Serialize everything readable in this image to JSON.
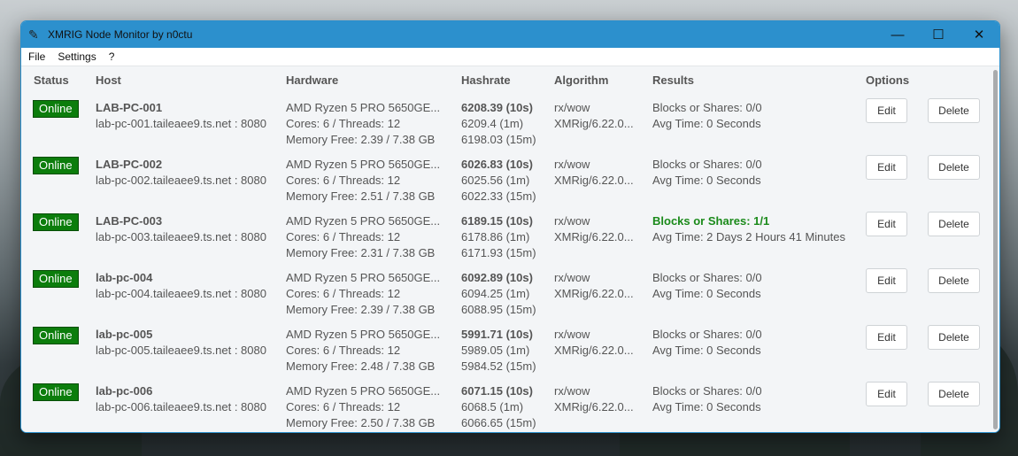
{
  "window": {
    "title": "XMRIG Node Monitor by n0ctu",
    "minimize": "—",
    "maximize": "☐",
    "close": "✕"
  },
  "menu": [
    "File",
    "Settings",
    "?"
  ],
  "headers": [
    "Status",
    "Host",
    "Hardware",
    "Hashrate",
    "Algorithm",
    "Results",
    "Options"
  ],
  "rows": [
    {
      "status": "Online",
      "name": "LAB-PC-001",
      "address": "lab-pc-001.taileaee9.ts.net : 8080",
      "cpu": "AMD Ryzen 5 PRO 5650GE...",
      "cores": "Cores: 6 / Threads: 12",
      "memory": "Memory Free: 2.39 / 7.38 GB",
      "h10s": "6208.39 (10s)",
      "h1m": "6209.4 (1m)",
      "h15m": "6198.03 (15m)",
      "algo": "rx/wow",
      "version": "XMRig/6.22.0...",
      "shares": "Blocks or Shares: 0/0",
      "avg": "Avg Time: 0 Seconds",
      "found": false,
      "edit": "Edit",
      "delete": "Delete"
    },
    {
      "status": "Online",
      "name": "LAB-PC-002",
      "address": "lab-pc-002.taileaee9.ts.net : 8080",
      "cpu": "AMD Ryzen 5 PRO 5650GE...",
      "cores": "Cores: 6 / Threads: 12",
      "memory": "Memory Free: 2.51 / 7.38 GB",
      "h10s": "6026.83 (10s)",
      "h1m": "6025.56 (1m)",
      "h15m": "6022.33 (15m)",
      "algo": "rx/wow",
      "version": "XMRig/6.22.0...",
      "shares": "Blocks or Shares: 0/0",
      "avg": "Avg Time: 0 Seconds",
      "found": false,
      "edit": "Edit",
      "delete": "Delete"
    },
    {
      "status": "Online",
      "name": "LAB-PC-003",
      "address": "lab-pc-003.taileaee9.ts.net : 8080",
      "cpu": "AMD Ryzen 5 PRO 5650GE...",
      "cores": "Cores: 6 / Threads: 12",
      "memory": "Memory Free: 2.31 / 7.38 GB",
      "h10s": "6189.15 (10s)",
      "h1m": "6178.86 (1m)",
      "h15m": "6171.93 (15m)",
      "algo": "rx/wow",
      "version": "XMRig/6.22.0...",
      "shares": "Blocks or Shares: 1/1",
      "avg": "Avg Time: 2 Days 2 Hours 41 Minutes",
      "found": true,
      "edit": "Edit",
      "delete": "Delete"
    },
    {
      "status": "Online",
      "name": "lab-pc-004",
      "address": "lab-pc-004.taileaee9.ts.net : 8080",
      "cpu": "AMD Ryzen 5 PRO 5650GE...",
      "cores": "Cores: 6 / Threads: 12",
      "memory": "Memory Free: 2.39 / 7.38 GB",
      "h10s": "6092.89 (10s)",
      "h1m": "6094.25 (1m)",
      "h15m": "6088.95 (15m)",
      "algo": "rx/wow",
      "version": "XMRig/6.22.0...",
      "shares": "Blocks or Shares: 0/0",
      "avg": "Avg Time: 0 Seconds",
      "found": false,
      "edit": "Edit",
      "delete": "Delete"
    },
    {
      "status": "Online",
      "name": "lab-pc-005",
      "address": "lab-pc-005.taileaee9.ts.net : 8080",
      "cpu": "AMD Ryzen 5 PRO 5650GE...",
      "cores": "Cores: 6 / Threads: 12",
      "memory": "Memory Free: 2.48 / 7.38 GB",
      "h10s": "5991.71 (10s)",
      "h1m": "5989.05 (1m)",
      "h15m": "5984.52 (15m)",
      "algo": "rx/wow",
      "version": "XMRig/6.22.0...",
      "shares": "Blocks or Shares: 0/0",
      "avg": "Avg Time: 0 Seconds",
      "found": false,
      "edit": "Edit",
      "delete": "Delete"
    },
    {
      "status": "Online",
      "name": "lab-pc-006",
      "address": "lab-pc-006.taileaee9.ts.net : 8080",
      "cpu": "AMD Ryzen 5 PRO 5650GE...",
      "cores": "Cores: 6 / Threads: 12",
      "memory": "Memory Free: 2.50 / 7.38 GB",
      "h10s": "6071.15 (10s)",
      "h1m": "6068.5 (1m)",
      "h15m": "6066.65 (15m)",
      "algo": "rx/wow",
      "version": "XMRig/6.22.0...",
      "shares": "Blocks or Shares: 0/0",
      "avg": "Avg Time: 0 Seconds",
      "found": false,
      "edit": "Edit",
      "delete": "Delete"
    }
  ],
  "colors": {
    "titlebar": "#2c90cd",
    "online": "#0c7d0c",
    "found": "#1a8a1a"
  }
}
